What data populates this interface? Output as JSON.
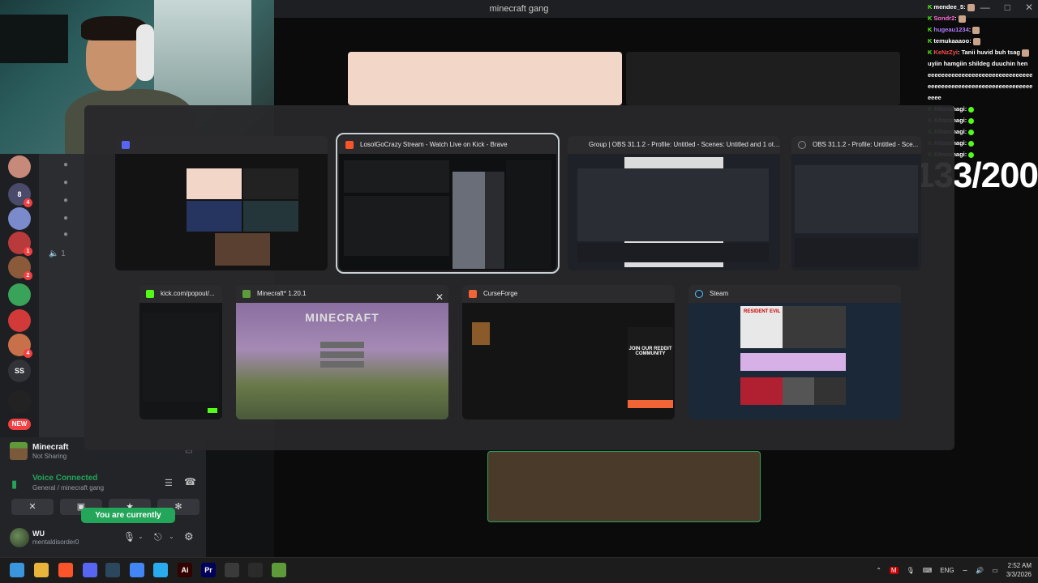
{
  "discord": {
    "window_title": "minecraft gang",
    "servers": [
      "",
      "8",
      "",
      "",
      "",
      "",
      "",
      "",
      "SS",
      ""
    ],
    "server_badges": [
      "",
      "4",
      "",
      "1",
      "2",
      "",
      "",
      "4",
      "",
      ""
    ],
    "new_label": "NEW",
    "volume_label": "1",
    "activity": {
      "game": "Minecraft",
      "status": "Not Sharing"
    },
    "voice": {
      "status": "Voice Connected",
      "channel": "General / minecraft gang"
    },
    "muted_tooltip": "You are currently muted!",
    "user": {
      "name": "WU",
      "handle": "mentaldisorder0"
    }
  },
  "chat": {
    "lines": [
      {
        "user": "mendee_5",
        "color": "#ffffff",
        "text": ":"
      },
      {
        "user": "Sondr2",
        "color": "#ff6fd8",
        "text": ":"
      },
      {
        "user": "hugeau1234",
        "color": "#b07cff",
        "text": ":"
      },
      {
        "user": "temukaaaoo",
        "color": "#ffffff",
        "text": ":"
      },
      {
        "user": "KeNzZyi",
        "color": "#ff4d4d",
        "text": ": Tanii huvid buh tsag"
      },
      {
        "user": "",
        "color": "#ffffff",
        "text": "uyiin hamgiin shildeg duuchin hen"
      },
      {
        "user": "",
        "color": "#ffffff",
        "text": "eeeeeeeeeeeeeeeeeeeeeeeeeeeeeee"
      },
      {
        "user": "",
        "color": "#ffffff",
        "text": "eeeeeeeeeeeeeeeeeeeeeeeeeeeeeee"
      },
      {
        "user": "",
        "color": "#ffffff",
        "text": "eeee"
      },
      {
        "user": "Altanshagi",
        "color": "#ffffff",
        "text": ":"
      },
      {
        "user": "Altanshagi",
        "color": "#ffffff",
        "text": ":"
      },
      {
        "user": "Altanshagi",
        "color": "#ffffff",
        "text": ":"
      },
      {
        "user": "Altanshagi",
        "color": "#ffffff",
        "text": ":"
      },
      {
        "user": "Altanshagi",
        "color": "#ffffff",
        "text": ":"
      }
    ],
    "counter": "133/200"
  },
  "switcher": {
    "windows": [
      {
        "title": "",
        "icon": "discord-icon",
        "icon_color": "#5865f2"
      },
      {
        "title": "LosolGoCrazy Stream - Watch Live on Kick - Brave",
        "icon": "brave-icon",
        "icon_color": "#fb542b"
      },
      {
        "title": "Group | OBS 31.1.2 - Profile: Untitled - Scenes: Untitled and 1 oth...",
        "icon": "obs-icon",
        "icon_color": "#303030"
      },
      {
        "title": "OBS 31.1.2 - Profile: Untitled - Sce...",
        "icon": "obs-icon",
        "icon_color": "#303030"
      },
      {
        "title": "kick.com/popout/...",
        "icon": "kick-icon",
        "icon_color": "#53fc18"
      },
      {
        "title": "Minecraft* 1.20.1",
        "icon": "minecraft-icon",
        "icon_color": "#5e9a3a"
      },
      {
        "title": "CurseForge",
        "icon": "curseforge-icon",
        "icon_color": "#f16436"
      },
      {
        "title": "Steam",
        "icon": "steam-icon",
        "icon_color": "#1b2838"
      }
    ],
    "minecraft_logo": "MINECRAFT",
    "curseforge_ad": "JOIN OUR REDDIT COMMUNITY",
    "steam_game": "RESIDENT EVIL"
  },
  "taskbar": {
    "apps": [
      {
        "name": "windows-start-icon",
        "label": "",
        "color": "#3a96dd"
      },
      {
        "name": "file-explorer-icon",
        "label": "",
        "color": "#e8b43a"
      },
      {
        "name": "brave-icon",
        "label": "",
        "color": "#fb542b"
      },
      {
        "name": "discord-icon",
        "label": "",
        "color": "#5865f2"
      },
      {
        "name": "steam-icon",
        "label": "",
        "color": "#2a475e"
      },
      {
        "name": "chrome-icon",
        "label": "",
        "color": "#4285f4"
      },
      {
        "name": "telegram-icon",
        "label": "",
        "color": "#2aabee"
      },
      {
        "name": "illustrator-icon",
        "label": "Ai",
        "color": "#330000"
      },
      {
        "name": "premiere-icon",
        "label": "Pr",
        "color": "#00005b"
      },
      {
        "name": "obs-icon",
        "label": "",
        "color": "#3a3a3a"
      },
      {
        "name": "kick-icon",
        "label": "",
        "color": "#2b2b2b"
      },
      {
        "name": "minecraft-icon",
        "label": "",
        "color": "#5e9a3a"
      }
    ],
    "language": "ENG",
    "time": "2:52 AM",
    "date": "3/3/2026"
  }
}
